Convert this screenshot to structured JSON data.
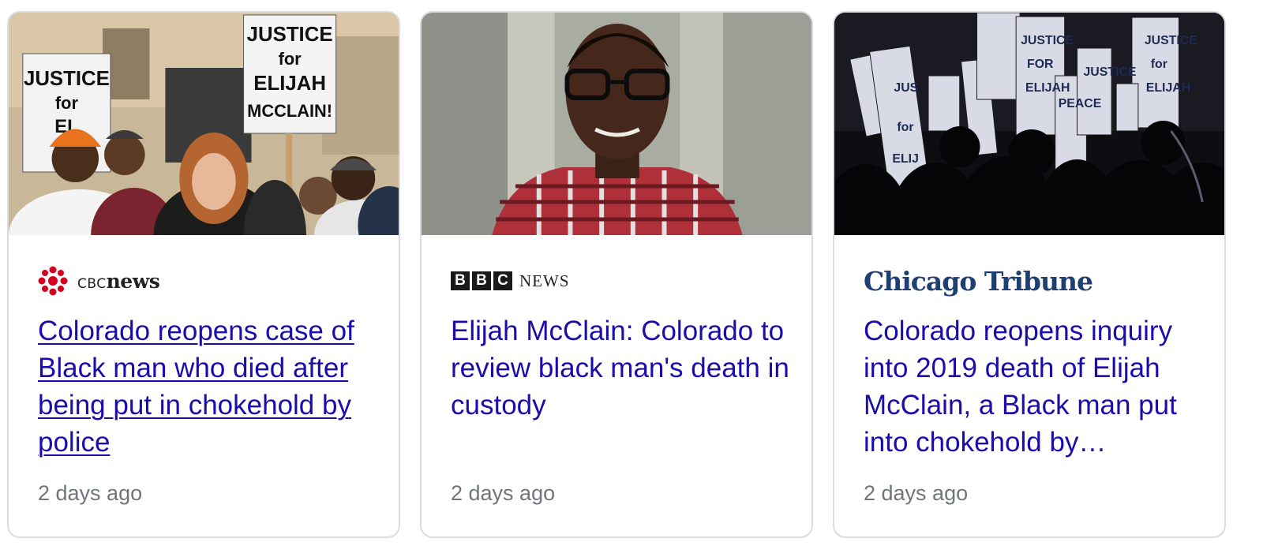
{
  "cards": [
    {
      "source": {
        "small": "CBC",
        "bold": "news"
      },
      "headline": "Colorado reopens case of Black man who died after being put in chokehold by police",
      "time": "2 days ago",
      "image": {
        "signs": [
          "JUSTICE for EL... M...",
          "JUSTICE for ELIJAH MCCLAIN!"
        ]
      }
    },
    {
      "source": {
        "letters": [
          "B",
          "B",
          "C"
        ],
        "word": "NEWS"
      },
      "headline": "Elijah McClain: Colorado to review black man's death in custody",
      "time": "2 days ago"
    },
    {
      "source": {
        "name": "Chicago Tribune"
      },
      "headline": "Colorado reopens inquiry into 2019 death of Elijah McClain, a Black man put into chokehold by…",
      "time": "2 days ago"
    }
  ],
  "colors": {
    "headline": "#1a0dab",
    "time": "#70757a",
    "border": "#dadce0",
    "cbc_red": "#d5001f",
    "tribune_blue": "#1f3f73"
  }
}
